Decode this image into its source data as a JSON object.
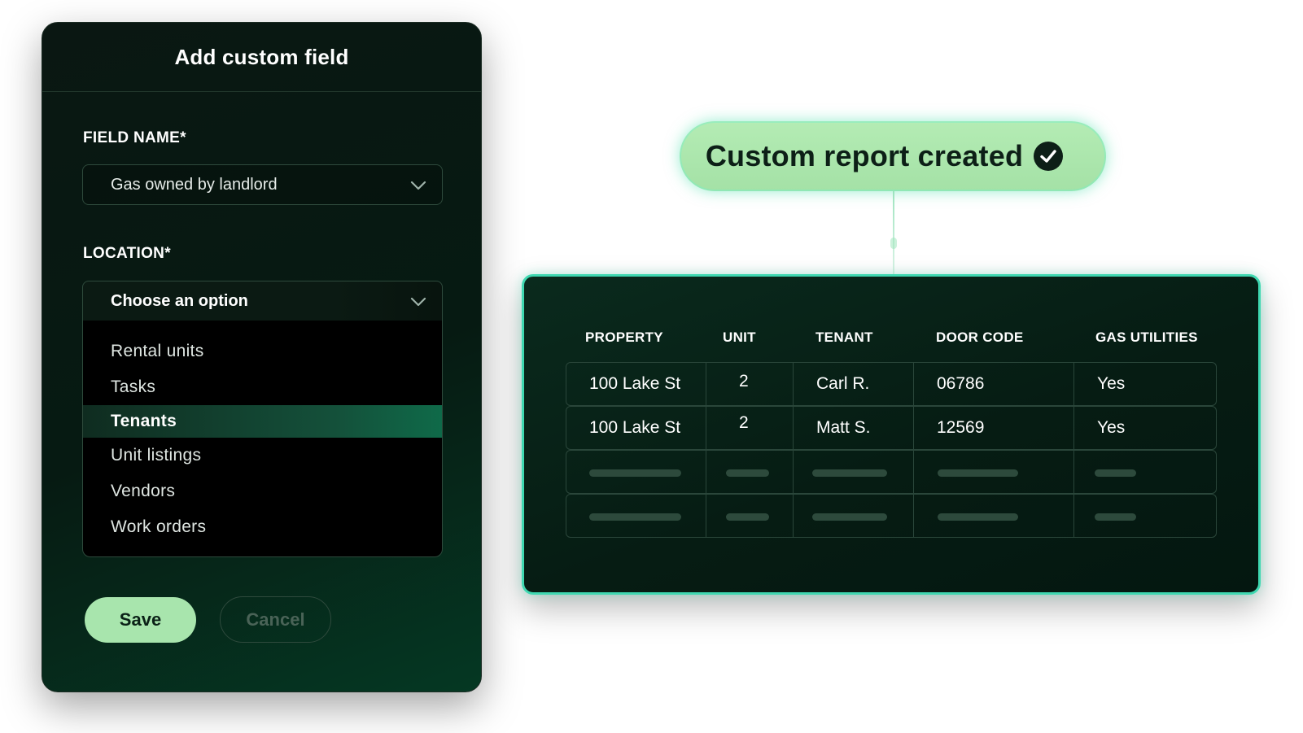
{
  "modal": {
    "title": "Add custom field",
    "field_name": {
      "label": "FIELD NAME*",
      "value": "Gas owned by landlord"
    },
    "location": {
      "label": "LOCATION*",
      "placeholder": "Choose an option",
      "options": [
        "Rental units",
        "Tasks",
        "Tenants",
        "Unit listings",
        "Vendors",
        "Work orders"
      ],
      "highlighted": "Tenants"
    },
    "save_label": "Save",
    "cancel_label": "Cancel"
  },
  "toast": {
    "text": "Custom report created",
    "icon": "check-circle-icon"
  },
  "report": {
    "columns": [
      "PROPERTY",
      "UNIT",
      "TENANT",
      "DOOR CODE",
      "GAS UTILITIES"
    ],
    "rows": [
      [
        "100 Lake St",
        "2",
        "Carl R.",
        "06786",
        "Yes"
      ],
      [
        "100 Lake St",
        "2",
        "Matt S.",
        "12569",
        "Yes"
      ]
    ]
  },
  "colors": {
    "accent_green": "#a8e5ad",
    "panel_border": "#3fd8b1",
    "modal_bg": "#0a1712"
  }
}
